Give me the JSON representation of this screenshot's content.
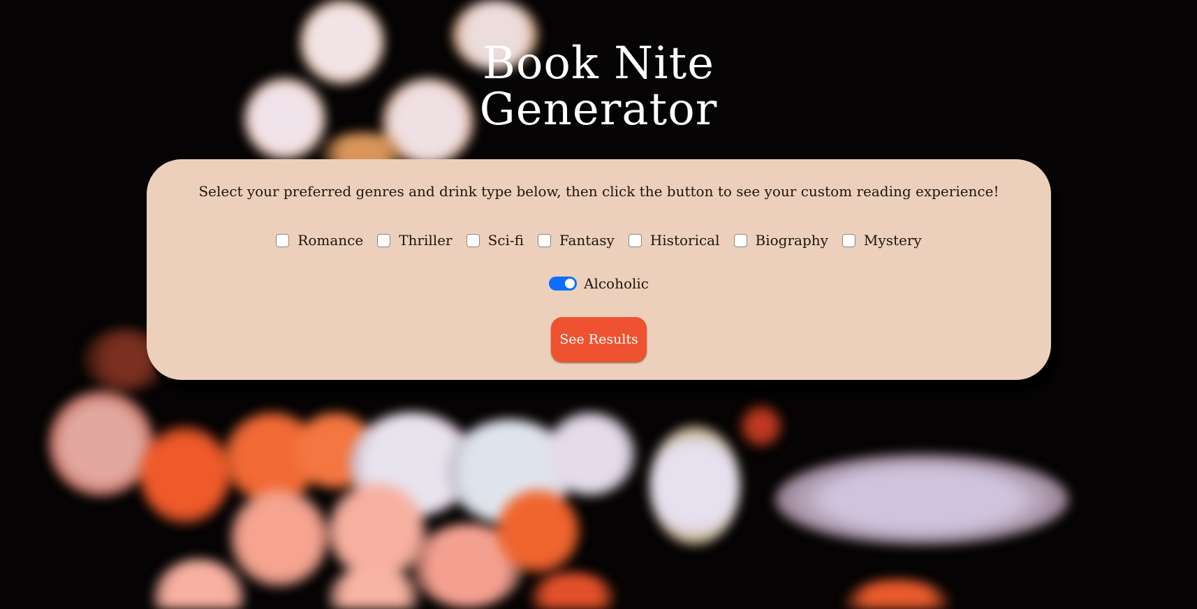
{
  "page": {
    "title_line1": "Book Nite",
    "title_line2": "Generator"
  },
  "card": {
    "instructions": "Select your preferred genres and drink type below, then click the button to see your custom reading experience!",
    "genres": [
      {
        "label": "Romance",
        "checked": false
      },
      {
        "label": "Thriller",
        "checked": false
      },
      {
        "label": "Sci-fi",
        "checked": false
      },
      {
        "label": "Fantasy",
        "checked": false
      },
      {
        "label": "Historical",
        "checked": false
      },
      {
        "label": "Biography",
        "checked": false
      },
      {
        "label": "Mystery",
        "checked": false
      }
    ],
    "drink_toggle": {
      "label": "Alcoholic",
      "on": true
    },
    "results_button_label": "See Results"
  },
  "colors": {
    "card_background": "#edd0bb",
    "button_accent": "#ee5230",
    "toggle_accent": "#0d6efd",
    "title_text": "#ffffff"
  }
}
